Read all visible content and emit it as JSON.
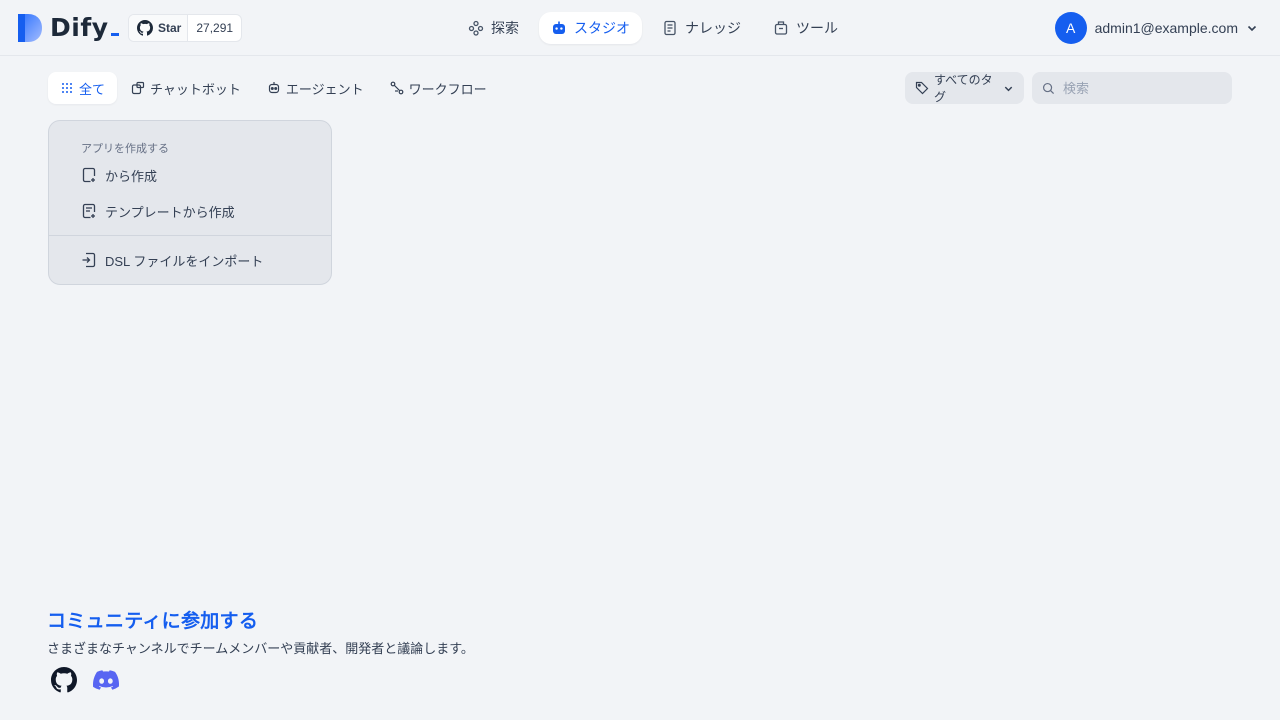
{
  "header": {
    "logo_text": "Dify",
    "github": {
      "star_label": "Star",
      "star_count": "27,291"
    },
    "nav": [
      {
        "label": "探索",
        "icon": "explore-icon"
      },
      {
        "label": "スタジオ",
        "icon": "robot-icon",
        "active": true
      },
      {
        "label": "ナレッジ",
        "icon": "book-icon"
      },
      {
        "label": "ツール",
        "icon": "briefcase-icon"
      }
    ],
    "user": {
      "avatar_initial": "A",
      "email": "admin1@example.com"
    }
  },
  "tabs": [
    {
      "label": "全て",
      "icon": "grid-dots-icon",
      "active": true
    },
    {
      "label": "チャットボット",
      "icon": "chat-bot-icon"
    },
    {
      "label": "エージェント",
      "icon": "agent-icon"
    },
    {
      "label": "ワークフロー",
      "icon": "workflow-icon"
    }
  ],
  "tag_filter": {
    "label": "すべてのタグ"
  },
  "search": {
    "placeholder": "検索"
  },
  "create_card": {
    "title": "アプリを作成する",
    "items": [
      {
        "label": "から作成",
        "icon": "file-plus-icon"
      },
      {
        "label": "テンプレートから作成",
        "icon": "file-template-icon"
      },
      {
        "label": "DSL ファイルをインポート",
        "icon": "file-import-icon"
      }
    ]
  },
  "community": {
    "title": "コミュニティに参加する",
    "description": "さまざまなチャンネルでチームメンバーや貢献者、開発者と議論します。",
    "links": [
      {
        "icon": "github-icon"
      },
      {
        "icon": "discord-icon"
      }
    ]
  },
  "colors": {
    "accent": "#155eef",
    "background": "#f2f4f7",
    "discord": "#5865f2"
  }
}
